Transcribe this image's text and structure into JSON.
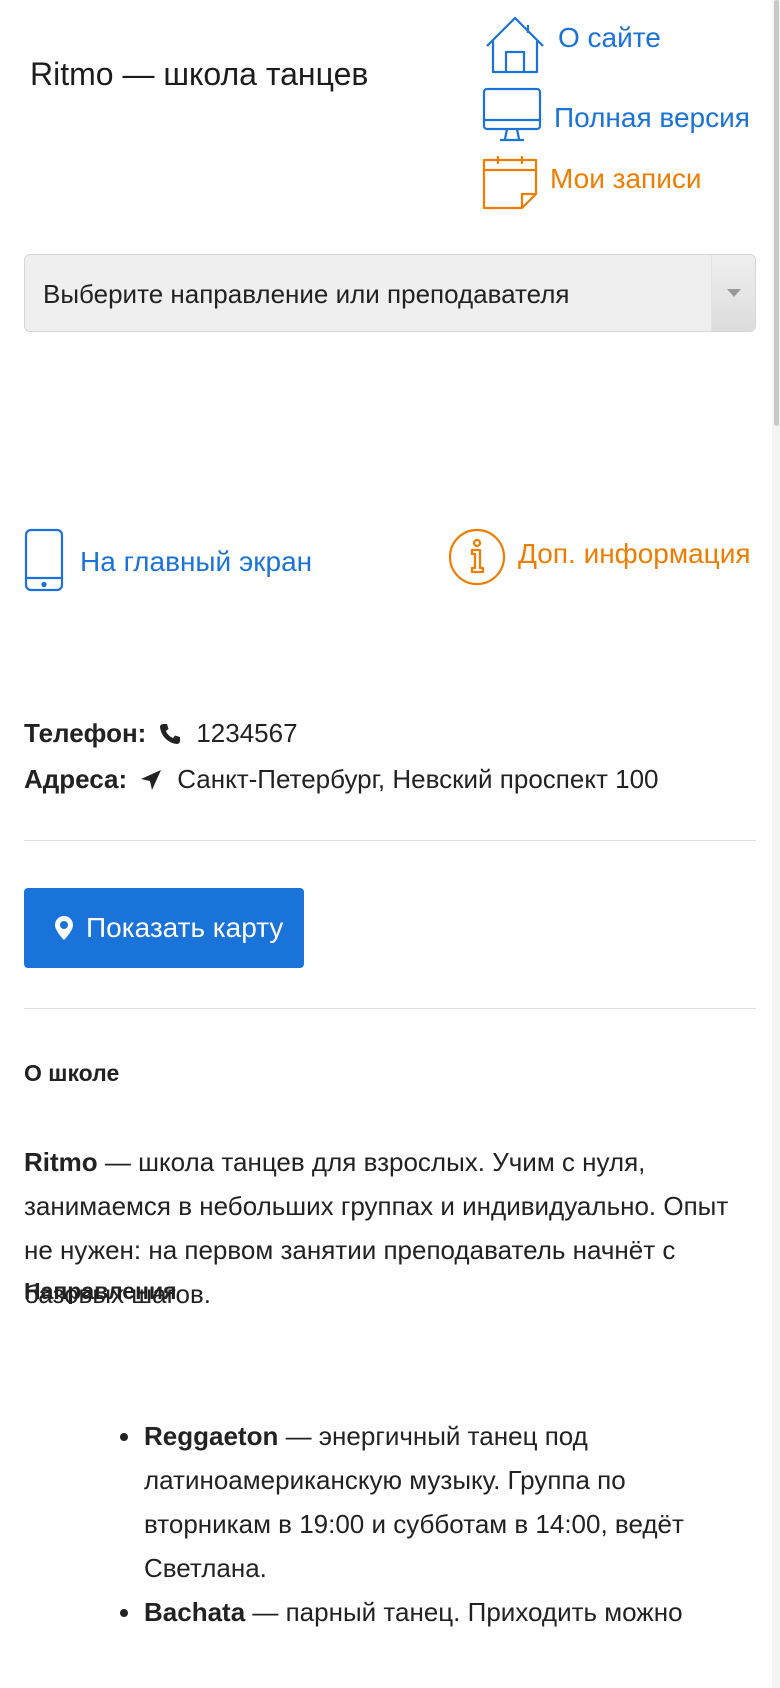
{
  "header": {
    "title": "Ritmo — школа танцев"
  },
  "nav": {
    "about": "О сайте",
    "full_version": "Полная версия",
    "my_records": "Мои записи",
    "home_screen": "На главный экран",
    "more_info": "Доп. информация"
  },
  "selector": {
    "placeholder": "Выберите направление или преподавателя"
  },
  "contacts": {
    "phone_label": "Телефон:",
    "phone_value": "1234567",
    "address_label": "Адреса:",
    "address_value": "Санкт-Петербург, Невский проспект 100"
  },
  "map_button": {
    "label": "Показать карту"
  },
  "about": {
    "heading": "О школе",
    "brand": "Ritmo",
    "text": " — школа танцев для взрослых. Учим с нуля, занимаемся в небольших группах и индивидуально. Опыт не нужен: на первом занятии преподаватель начнёт с базовых шагов."
  },
  "directions": {
    "heading": "Направления",
    "items": [
      {
        "name": "Reggaeton",
        "text": " — энергичный танец под латиноамериканскую музыку. Группа по вторникам в 19:00 и субботам в 14:00, ведёт Светлана."
      },
      {
        "name": "Bachata",
        "text": " — парный танец. Приходить можно"
      }
    ]
  },
  "colors": {
    "link_blue": "#1a73d9",
    "accent_orange": "#f07d00",
    "button_blue": "#1a73d9"
  }
}
